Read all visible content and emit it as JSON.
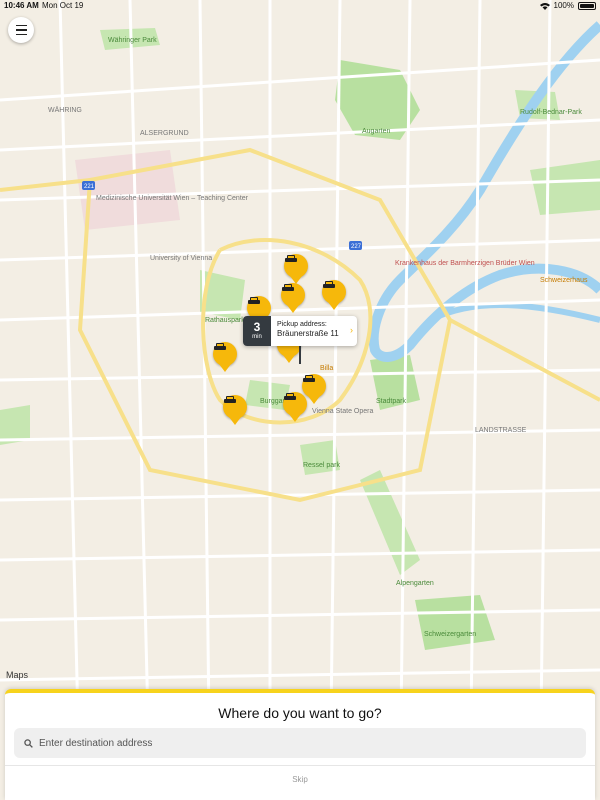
{
  "status_bar": {
    "time": "10:46 AM",
    "date": "Mon Oct 19",
    "battery": "100%",
    "icons": [
      "wifi-icon",
      "battery-icon"
    ]
  },
  "map": {
    "attribution": "Maps",
    "labels": {
      "wahring": "WÄHRING",
      "alsergrund": "ALSERGRUND",
      "augarten": "Augarten",
      "rudolf": "Rudolf-Bednar-Park",
      "wahringer_park": "Währinger Park",
      "landstrasse": "LANDSTRASSE",
      "stadtpark": "Stadtpark",
      "rathauspark": "Rathauspark",
      "burggarten": "Burggarten",
      "rosselpark": "Ressel park",
      "schweizergarten": "Schweizergarten",
      "alpengarten": "Alpengarten",
      "medical_uni": "Medizinische Universität Wien – Teaching Center",
      "uni_vienna": "University of Vienna",
      "state_opera": "Vienna State Opera",
      "karlskirche": "Karlskirche",
      "billa": "Billa",
      "schweizerhaus": "Schweizerhaus",
      "krankenhaus": "Krankenhaus der Barmherzigen Brüder Wien",
      "route_221": "221",
      "route_227": "227"
    },
    "accent_color": "#f6b80b",
    "water_color": "#9fd1f0",
    "park_color": "#b8e0a0",
    "road_color": "#ffffff",
    "highway_color": "#f7e08a"
  },
  "menu_icon": "menu-icon",
  "pickup": {
    "eta_value": "3",
    "eta_unit": "min",
    "label": "Pickup address:",
    "address": "Bräunerstraße 11",
    "chevron": "›"
  },
  "taxis": [
    {
      "name": "taxi-1"
    },
    {
      "name": "taxi-2"
    },
    {
      "name": "taxi-3"
    },
    {
      "name": "taxi-4"
    },
    {
      "name": "taxi-5"
    },
    {
      "name": "taxi-6"
    },
    {
      "name": "taxi-7"
    },
    {
      "name": "taxi-8"
    }
  ],
  "sheet": {
    "title": "Where do you want to go?",
    "search_placeholder": "Enter destination address",
    "skip_label": "Skip",
    "accent": "#f7d31c"
  }
}
